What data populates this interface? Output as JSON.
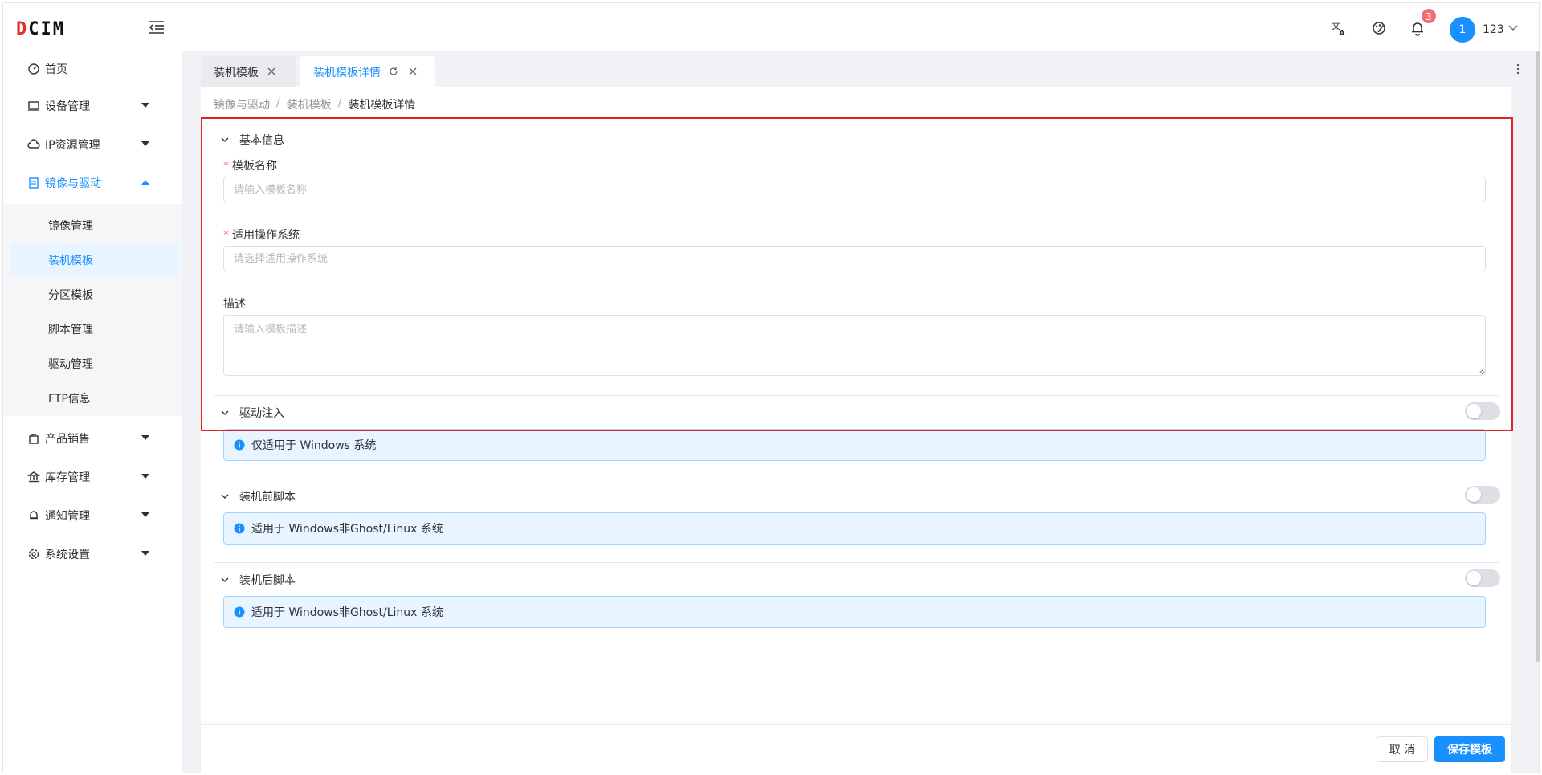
{
  "header": {
    "logo_text": "CIM",
    "logo_mark": "D",
    "notification_count": "3",
    "avatar_initial": "1",
    "username": "123"
  },
  "sidebar": {
    "items": [
      {
        "label": "首页",
        "icon": "dashboard-icon"
      },
      {
        "label": "设备管理",
        "icon": "monitor-icon"
      },
      {
        "label": "IP资源管理",
        "icon": "cloud-icon"
      },
      {
        "label": "镜像与驱动",
        "icon": "document-icon"
      },
      {
        "label": "产品销售",
        "icon": "bag-icon"
      },
      {
        "label": "库存管理",
        "icon": "bank-icon"
      },
      {
        "label": "通知管理",
        "icon": "bell-icon"
      },
      {
        "label": "系统设置",
        "icon": "gear-icon"
      }
    ],
    "submenu": [
      {
        "label": "镜像管理"
      },
      {
        "label": "装机模板"
      },
      {
        "label": "分区模板"
      },
      {
        "label": "脚本管理"
      },
      {
        "label": "驱动管理"
      },
      {
        "label": "FTP信息"
      }
    ],
    "accent": "#1890ff"
  },
  "tabs": [
    {
      "label": "装机模板"
    },
    {
      "label": "装机模板详情"
    }
  ],
  "breadcrumb": [
    "镜像与驱动",
    "装机模板",
    "装机模板详情"
  ],
  "breadcrumb_sep": "/",
  "basic_info": {
    "title": "基本信息",
    "name_label": "模板名称",
    "name_placeholder": "请输入模板名称",
    "os_label": "适用操作系统",
    "os_placeholder": "请选择适用操作系统",
    "desc_label": "描述",
    "desc_placeholder": "请输入模板描述",
    "required_mark": "*"
  },
  "sections": [
    {
      "title": "驱动注入",
      "enabled": false,
      "notice": "仅适用于 Windows 系统"
    },
    {
      "title": "装机前脚本",
      "enabled": false,
      "notice": "适用于 Windows非Ghost/Linux 系统"
    },
    {
      "title": "装机后脚本",
      "enabled": false,
      "notice": "适用于 Windows非Ghost/Linux 系统"
    }
  ],
  "footer": {
    "cancel_label": "取 消",
    "save_label": "保存模板"
  }
}
